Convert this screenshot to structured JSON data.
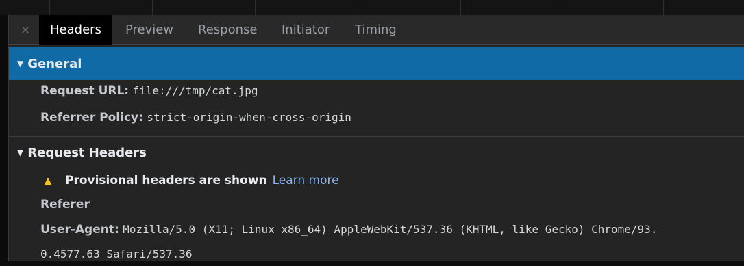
{
  "tabs": [
    {
      "label": "Headers",
      "active": true
    },
    {
      "label": "Preview",
      "active": false
    },
    {
      "label": "Response",
      "active": false
    },
    {
      "label": "Initiator",
      "active": false
    },
    {
      "label": "Timing",
      "active": false
    }
  ],
  "close_glyph": "×",
  "general": {
    "title": "General",
    "request_url_label": "Request URL:",
    "request_url_value": "file:///tmp/cat.jpg",
    "referrer_policy_label": "Referrer Policy:",
    "referrer_policy_value": "strict-origin-when-cross-origin"
  },
  "request_headers": {
    "title": "Request Headers",
    "warning_text": "Provisional headers are shown",
    "learn_more": "Learn more",
    "referer_label": "Referer",
    "user_agent_label": "User-Agent:",
    "user_agent_value_line1": "Mozilla/5.0 (X11; Linux x86_64) AppleWebKit/537.36 (KHTML, like Gecko) Chrome/93.",
    "user_agent_value_line2": "0.4577.63 Safari/537.36"
  },
  "colors": {
    "selected_row": "#0f6aa6",
    "warning": "#f2c21b",
    "link": "#8ab4f8"
  },
  "icons": {
    "close": "close-icon",
    "expand": "triangle-down-icon",
    "warning": "warning-icon"
  }
}
